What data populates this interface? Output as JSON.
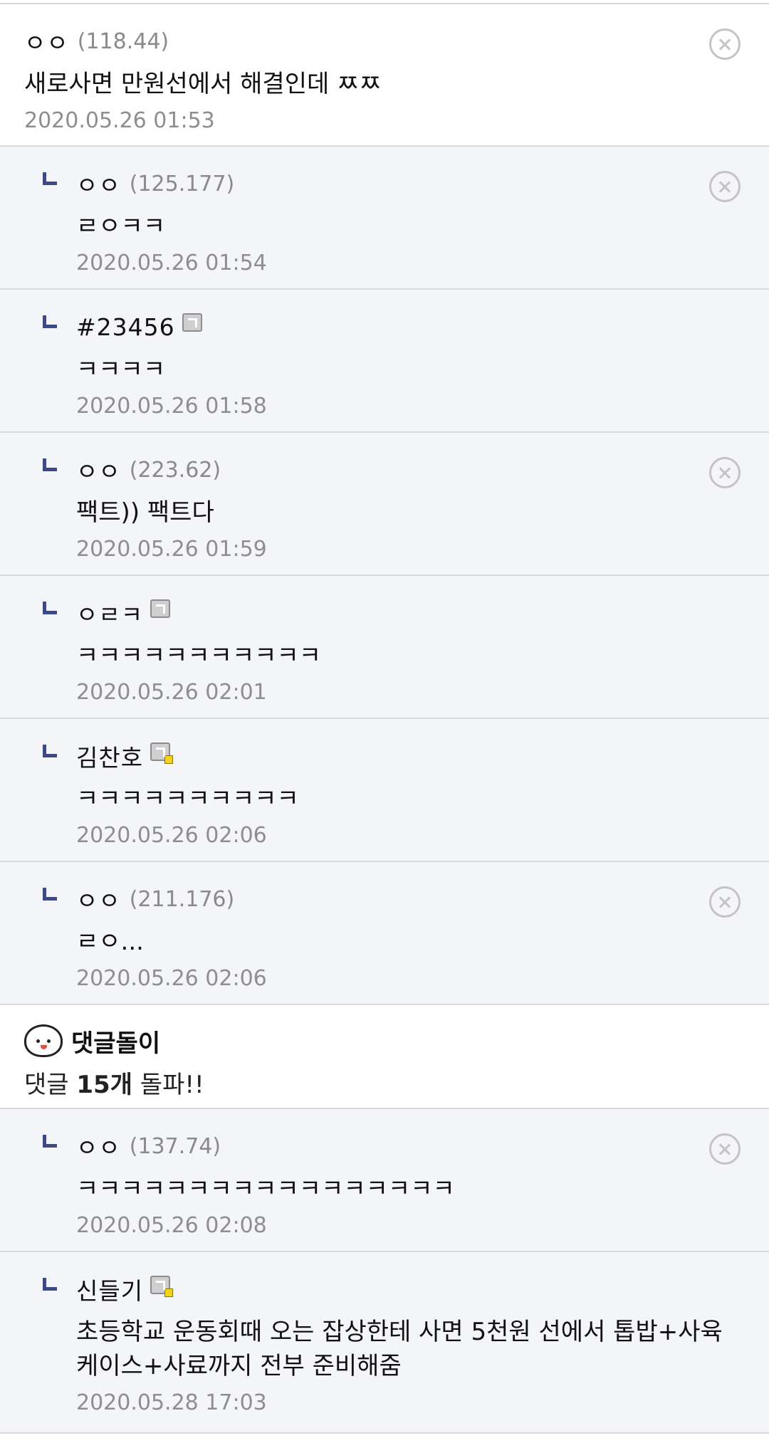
{
  "comments": [
    {
      "nick": "ㅇㅇ",
      "ip": "(118.44)",
      "text": "새로사면 만원선에서 해결인데 ㅉㅉ",
      "date": "2020.05.26 01:53"
    },
    {
      "nick": "ㅇㅇ",
      "ip": "(125.177)",
      "text": "ㄹㅇㅋㅋ",
      "date": "2020.05.26 01:54"
    },
    {
      "nick": "#23456",
      "text": "ㅋㅋㅋㅋ",
      "date": "2020.05.26 01:58"
    },
    {
      "nick": "ㅇㅇ",
      "ip": "(223.62)",
      "text": "팩트)) 팩트다",
      "date": "2020.05.26 01:59"
    },
    {
      "nick": "ㅇㄹㅋ",
      "text": "ㅋㅋㅋㅋㅋㅋㅋㅋㅋㅋㅋ",
      "date": "2020.05.26 02:01"
    },
    {
      "nick": "김찬호",
      "text": "ㅋㅋㅋㅋㅋㅋㅋㅋㅋㅋ",
      "date": "2020.05.26 02:06"
    },
    {
      "nick": "ㅇㅇ",
      "ip": "(211.176)",
      "text": "ㄹㅇ...",
      "date": "2020.05.26 02:06"
    },
    {
      "nick": "ㅇㅇ",
      "ip": "(137.74)",
      "text": "ㅋㅋㅋㅋㅋㅋㅋㅋㅋㅋㅋㅋㅋㅋㅋㅋㅋ",
      "date": "2020.05.26 02:08"
    },
    {
      "nick": "신들기",
      "text": "초등학교 운동회때 오는 잡상한테 사면 5천원 선에서 톱밥+사육 케이스+사료까지 전부 준비해줌",
      "date": "2020.05.28 17:03"
    }
  ],
  "bot": {
    "name": "댓글돌이",
    "msg_prefix": "댓글 ",
    "msg_count": "15개",
    "msg_suffix": " 돌파!!"
  }
}
